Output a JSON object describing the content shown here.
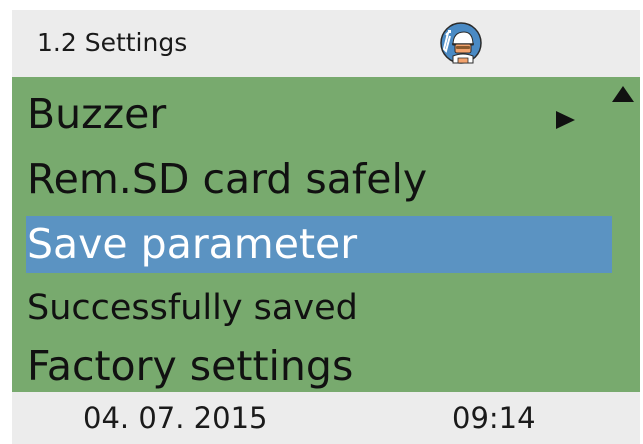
{
  "header": {
    "title": "1.2 Settings",
    "avatar_icon": "technician-icon"
  },
  "menu": {
    "items": [
      {
        "label": "Buzzer"
      },
      {
        "label": "Rem.SD card safely"
      },
      {
        "label": "Save parameter",
        "selected": true
      },
      {
        "label": "Successfully saved"
      },
      {
        "label": "Factory settings"
      }
    ],
    "submenu_icon": "arrow-right-icon",
    "scroll_icon": "scroll-up-icon"
  },
  "footer": {
    "date": "04. 07. 2015",
    "time": "09:14"
  },
  "colors": {
    "menu_background": "#78aa6e",
    "selected_background": "#5b93c2",
    "header_background": "#ececec",
    "avatar_background": "#4a8ac4",
    "avatar_skin": "#f3a36d"
  }
}
